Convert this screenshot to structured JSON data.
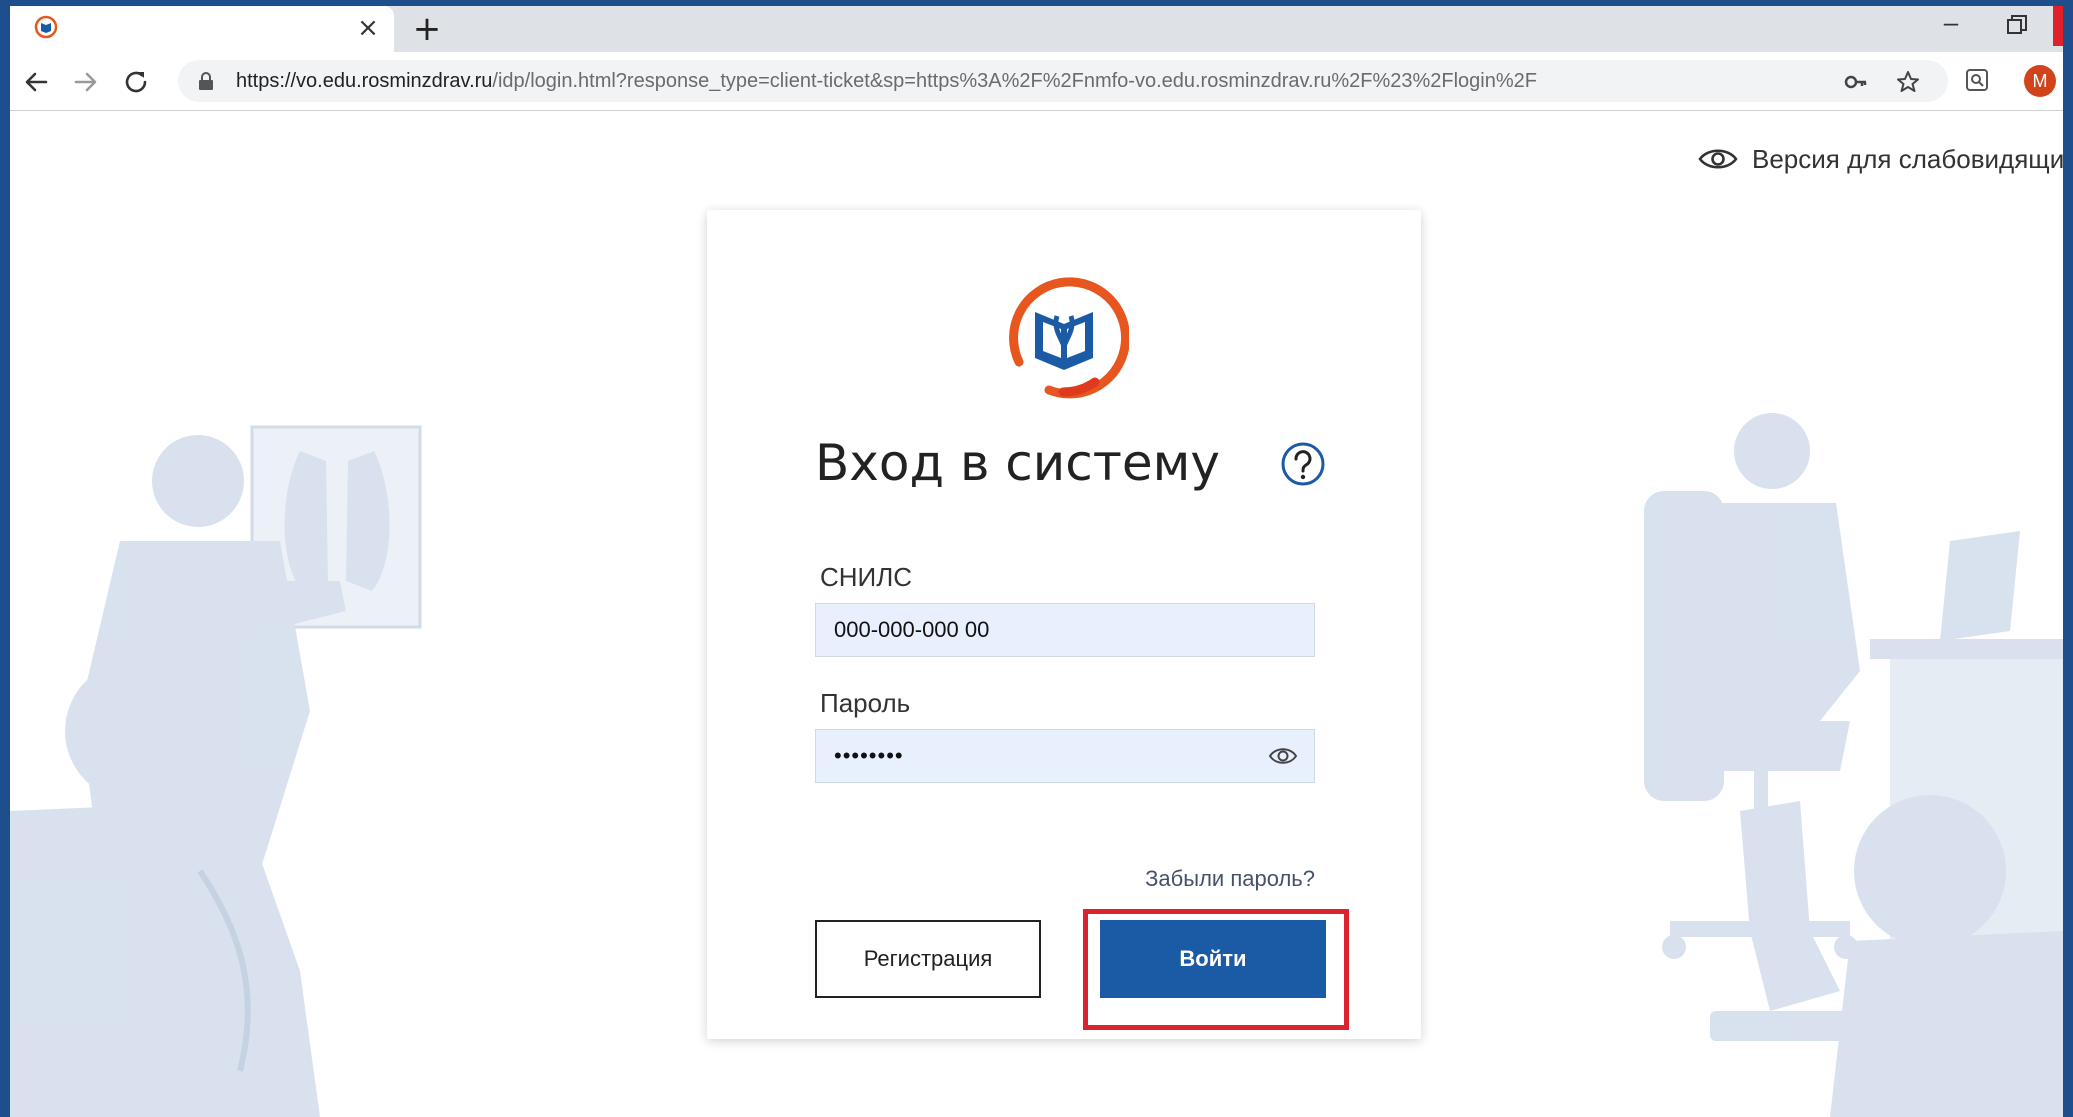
{
  "browser": {
    "tab_close": "×",
    "new_tab": "+",
    "minimize": "–",
    "url_host": "https://vo.edu.rosminzdrav.ru",
    "url_path": "/idp/login.html?response_type=client-ticket&sp=https%3A%2F%2Fnmfo-vo.edu.rosminzdrav.ru%2F%23%2Flogin%2F",
    "profile_initial": "M",
    "icons": [
      "back-icon",
      "forward-icon",
      "reload-icon",
      "lock-icon",
      "key-icon",
      "star-icon",
      "extension-icon"
    ]
  },
  "page": {
    "accessibility_link": "Версия для слабовидящих",
    "login": {
      "title": "Вход в систему",
      "snils_label": "СНИЛС",
      "snils_value": "000-000-000 00",
      "password_label": "Пароль",
      "password_mask": "••••••••",
      "forgot_password": "Забыли пароль?",
      "register_button": "Регистрация",
      "login_button": "Войти"
    }
  },
  "colors": {
    "primary_button": "#1b5aa5",
    "highlight": "#d9232f",
    "field_bg": "#e8f0fe",
    "logo_ring": "#e8561f",
    "logo_book": "#1b5aa5"
  }
}
